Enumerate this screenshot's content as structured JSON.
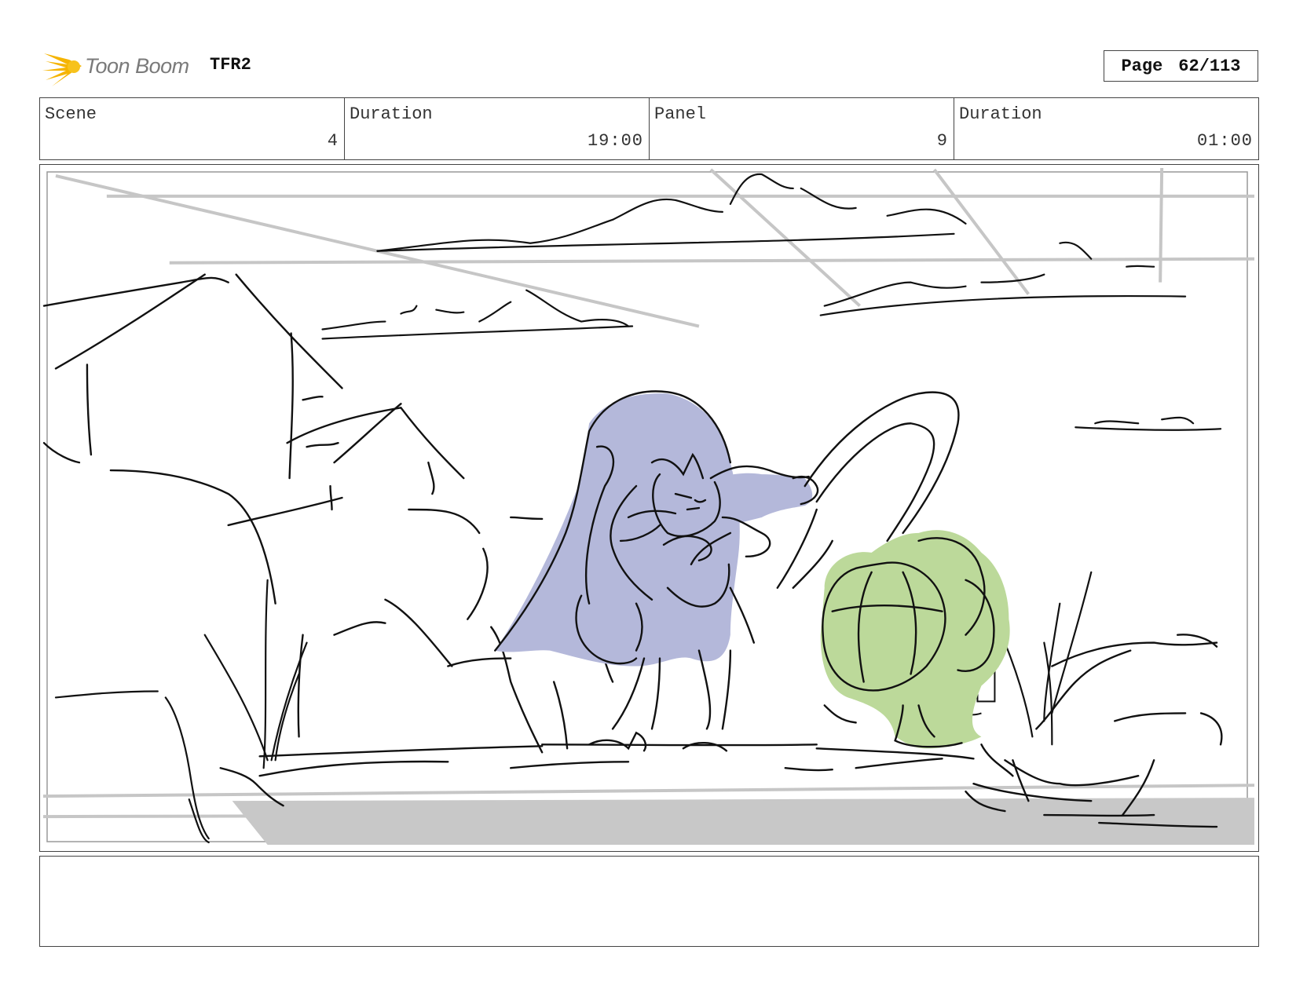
{
  "header": {
    "brand": "Toon Boom",
    "logo_icon": "star-burst-icon",
    "brand_color": "#f5b400",
    "project": "TFR2",
    "page_label": "Page",
    "page_value": "62/113"
  },
  "info": {
    "scene_label": "Scene",
    "scene_value": "4",
    "scene_duration_label": "Duration",
    "scene_duration_value": "19:00",
    "panel_label": "Panel",
    "panel_value": "9",
    "panel_duration_label": "Duration",
    "panel_duration_value": "01:00"
  },
  "panel": {
    "colors": {
      "cape_fill": "#b4b8da",
      "creature_fill": "#bcd99a",
      "ground_fill": "#c8c8c8",
      "sketch_line": "#111111",
      "guide_line": "#c6c6c6"
    }
  },
  "notes": {
    "text": ""
  }
}
